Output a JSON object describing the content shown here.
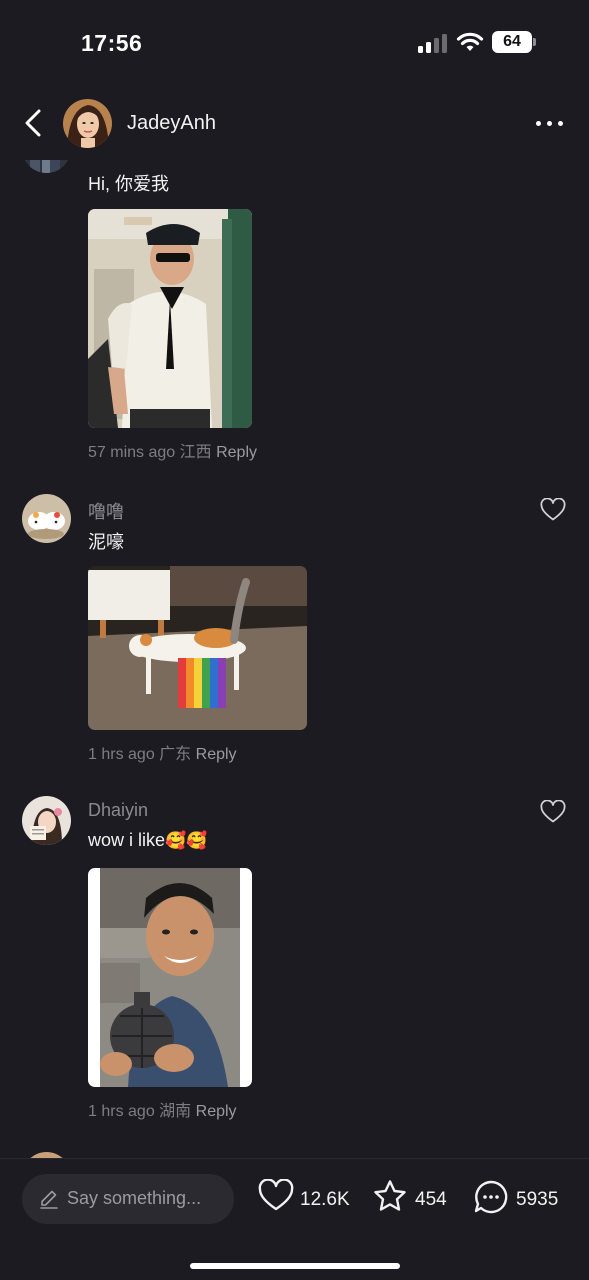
{
  "status": {
    "time": "17:56",
    "battery": "64"
  },
  "header": {
    "username": "JadeyAnh"
  },
  "comments": [
    {
      "username": "",
      "text": "Hi,  你爱我",
      "time": "57 mins ago",
      "location": "江西",
      "reply": "Reply"
    },
    {
      "username": "噜噜",
      "text": "泥嚎",
      "time": "1 hrs ago",
      "location": "广东",
      "reply": "Reply"
    },
    {
      "username": "Dhaiyin",
      "text": "wow i like",
      "emoji": "🥰🥰",
      "time": "1 hrs ago",
      "location": "湖南",
      "reply": "Reply"
    }
  ],
  "bottom": {
    "placeholder": "Say something...",
    "likes": "12.6K",
    "favorites": "454",
    "comments": "5935"
  },
  "colors": {
    "background": "#1c1b21",
    "muted_text": "#8a8a90",
    "input_bg": "#2b2a31"
  },
  "icons": [
    "back-icon",
    "more-icon",
    "heart-icon",
    "star-icon",
    "comment-bubble-icon",
    "pencil-icon",
    "signal-icon",
    "wifi-icon",
    "battery-icon"
  ]
}
